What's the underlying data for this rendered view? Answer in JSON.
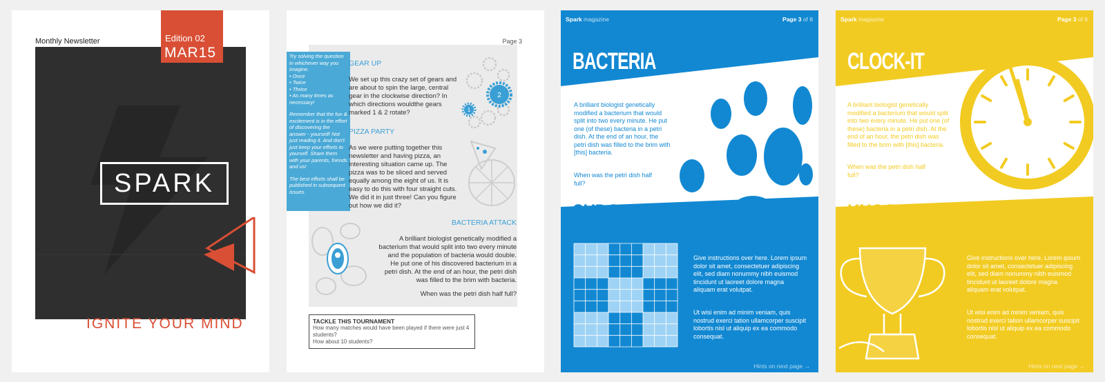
{
  "cover": {
    "subtitle": "Monthly Newsletter",
    "edition": "Edition 02",
    "date": "MAR15",
    "logo": "SPARK",
    "tagline": "IGNITE YOUR MIND",
    "accent_color": "#d94f35"
  },
  "puzzles": {
    "page_number": "Page 3",
    "sidebar": {
      "intro": "Try solving the question in whichever way you imagine.",
      "options": [
        "• Once",
        "• Twice",
        "• Thrice",
        "• As many times as necessary!"
      ],
      "remember": "Remember that the fun & excitement is in the effort of discovering the answer - yourself! Not just reading it. And don't just keep your efforts to yourself. Share them with your parents, friends and us!",
      "published": "The best efforts shall be published in subsequent issues."
    },
    "gear": {
      "title": "GEAR UP",
      "body": "We set up this crazy set of gears and are about to spin the large, central gear in the clockwise direction? In which directions wouldthe gears marked 1 & 2 rotate?",
      "gear1": "1",
      "gear2": "2"
    },
    "pizza": {
      "title": "PIZZA PARTY",
      "body": "As we were putting together this newsletter and having pizza, an interesting situation came up. The pizza was to be sliced and served equally among the eight of us. It is easy to do this with four straight cuts. We did it in just three! Can you figure out how we did it?"
    },
    "bacteria": {
      "title": "BACTERIA ATTACK",
      "body": "A brilliant biologist genetically modified a bacterium that would split into two every minute and the population of bacteria would double. He put one of his discovered bacterium in a petri dish. At the end of an hour, the petri dish was filled to the brim with bacteria.",
      "question": "When was the petri dish half full?"
    },
    "tournament": {
      "title": "TACKLE THIS TOURNAMENT",
      "q1": "How many matches would have been played if there were just 4 students?",
      "q2": "How about 10 students?"
    },
    "highlight_color": "#4aa9d6"
  },
  "blue_page": {
    "brand": "Spark",
    "brand_suffix": "magazine",
    "page": "Page 3",
    "of": "of 8",
    "heading1": "BACTERIA",
    "body1": "A brilliant biologist genetically modified a bacterium that would split into two every minute. He put one (of these) bacteria in a petri dish. At the end of an hour, the petri dish was filled to the brim with [this] bacteria.",
    "q1": "When was the petri dish half full?",
    "heading2": "SUDOKU",
    "body2a": "Give instructions over here. Lorem ipsum dolor sit amet, consectetuer adipiscing elit, sed diam nonummy nibh euismod tincidunt ut laoreet dolore magna aliquam erat volutpat.",
    "body2b": "Ut wisi enim ad minim veniam, quis nostrud exerci tation ullamcorper suscipit lobortis nisl ut aliquip ex ea commodo consequat.",
    "hint": "Hints on next page →",
    "color": "#1288d2"
  },
  "yellow_page": {
    "brand": "Spark",
    "brand_suffix": "magazine",
    "page": "Page 3",
    "of": "of 8",
    "heading1": "CLOCK-IT",
    "body1": "A brilliant biologist genetically modified a bacterium that would split into two every minute. He put one (of these) bacteria in a petri dish. At the end of an hour, the petri dish was filled to the brim with [this] bacteria.",
    "q1": "When was the petri dish half full?",
    "heading2": "KNOCKOUT TOURNAMENT",
    "body2a": "Give instructions over here. Lorem ipsum dolor sit amet, consectetuer adipiscing elit, sed diam nonummy nibh euismod tincidunt ut laoreet dolore magna aliquam erat volutpat.",
    "body2b": "Ut wisi enim ad minim veniam, quis nostrud exerci tation ullamcorper suscipit lobortis nisl ut aliquip ex ea commodo consequat.",
    "hint": "Hints on next page →",
    "color": "#f2cb22"
  }
}
